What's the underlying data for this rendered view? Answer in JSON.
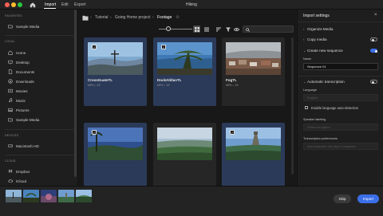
{
  "window": {
    "title": "Hiking",
    "menu": [
      "Import",
      "Edit",
      "Export"
    ]
  },
  "sidebar": {
    "favorites_heading": "FAVORITES",
    "favorites": [
      {
        "label": "Sample Media",
        "icon": "folder-icon"
      }
    ],
    "local_heading": "LOCAL",
    "local": [
      {
        "label": "Home",
        "icon": "home-icon"
      },
      {
        "label": "Desktop",
        "icon": "desktop-icon"
      },
      {
        "label": "Documents",
        "icon": "documents-icon"
      },
      {
        "label": "Downloads",
        "icon": "downloads-icon"
      },
      {
        "label": "Movies",
        "icon": "movies-icon"
      },
      {
        "label": "Music",
        "icon": "music-icon"
      },
      {
        "label": "Pictures",
        "icon": "pictures-icon"
      },
      {
        "label": "Sample Media",
        "icon": "folder-icon"
      }
    ],
    "devices_heading": "DEVICES",
    "devices": [
      {
        "label": "Macintosh HD",
        "icon": "drive-icon"
      }
    ],
    "cloud_heading": "CLOUD",
    "cloud": [
      {
        "label": "Dropbox",
        "icon": "dropbox-icon"
      },
      {
        "label": "iCloud",
        "icon": "cloud-icon"
      }
    ]
  },
  "breadcrumb": [
    "Tutorial",
    "Going Home project",
    "Footage"
  ],
  "toolbar": {
    "view_modes": [
      "grid-view",
      "list-view"
    ]
  },
  "clips": [
    {
      "name": "CrossGuateTL",
      "meta": "MP4 • :22",
      "selected": true
    },
    {
      "name": "DockAtitlanTL",
      "meta": "MP4 • :22",
      "selected": true
    },
    {
      "name": "FogTL",
      "meta": "MP4 • :22",
      "selected": false
    },
    {
      "name": "",
      "meta": "",
      "selected": true
    },
    {
      "name": "",
      "meta": "",
      "selected": false
    },
    {
      "name": "",
      "meta": "",
      "selected": true
    }
  ],
  "panel": {
    "title": "Import settings",
    "organize_media": "Organize Media",
    "copy_media": "Copy media",
    "copy_media_on": false,
    "create_sequence": "Create new sequence",
    "create_sequence_on": true,
    "name_label": "Name",
    "name_value": "Sequence 01",
    "auto_transcription": "Automatic transcription",
    "auto_transcription_on": false,
    "language_label": "Language",
    "language_value": "English",
    "language_auto": "Enable language auto-detection",
    "speaker_label": "Speaker labeling",
    "speaker_value": "Select an option",
    "transcription_prefs_label": "Transcription preferences",
    "transcription_prefs_value": "Auto-transcribe only clips in sequence"
  },
  "footer": {
    "skip_label": "Skip",
    "import_label": "Import",
    "accent": "#3b6fe8"
  }
}
